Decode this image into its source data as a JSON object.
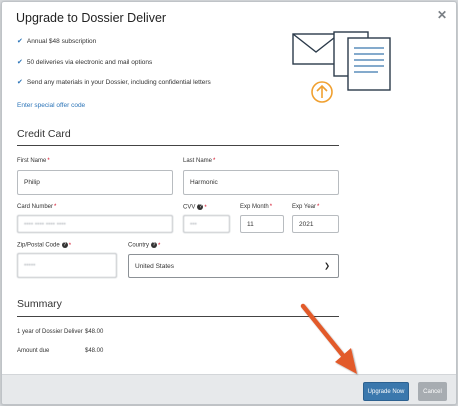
{
  "modal": {
    "title": "Upgrade to Dossier Deliver",
    "close_symbol": "✕"
  },
  "features": [
    "Annual $48 subscription",
    "50 deliveries via electronic and mail options",
    "Send any materials in your Dossier, including confidential letters"
  ],
  "special_offer_link": "Enter special offer code",
  "credit_card": {
    "heading": "Credit Card",
    "first_name_label": "First Name",
    "first_name_value": "Philip",
    "last_name_label": "Last Name",
    "last_name_value": "Harmonic",
    "card_number_label": "Card Number",
    "card_number_value": "•••• •••• •••• ••••",
    "cvv_label": "CVV",
    "cvv_value": "•••",
    "exp_month_label": "Exp Month",
    "exp_month_value": "11",
    "exp_year_label": "Exp Year",
    "exp_year_value": "2021",
    "zip_label": "Zip/Postal Code",
    "zip_value": "•••••",
    "country_label": "Country",
    "country_value": "United States",
    "required_mark": "*",
    "help_mark": "?"
  },
  "summary": {
    "heading": "Summary",
    "rows": [
      {
        "label": "1 year of Dossier Deliver",
        "amount": "$48.00"
      },
      {
        "label": "Amount due",
        "amount": "$48.00"
      }
    ]
  },
  "buttons": {
    "upgrade": "Upgrade Now",
    "cancel": "Cancel"
  },
  "colors": {
    "primary": "#3b78ad",
    "link": "#2b74b8",
    "annotation_arrow": "#e25a2a",
    "required": "#d0021b"
  }
}
